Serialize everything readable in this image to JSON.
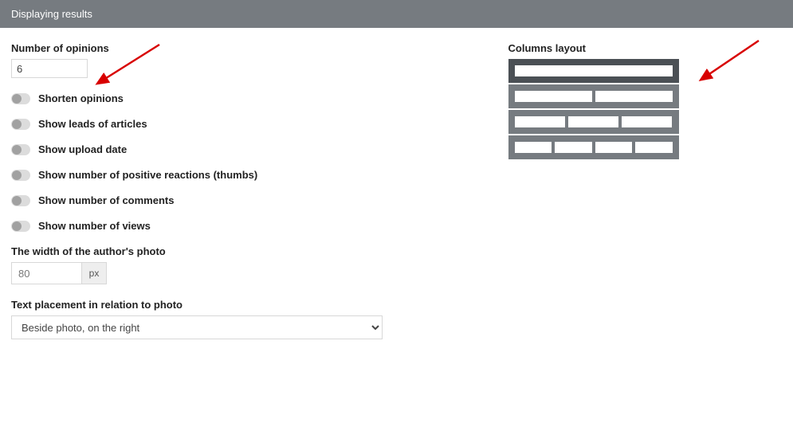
{
  "header": {
    "title": "Displaying results"
  },
  "left": {
    "number_of_opinions_label": "Number of opinions",
    "number_of_opinions_value": "6",
    "toggles": [
      {
        "label": "Shorten opinions"
      },
      {
        "label": "Show leads of articles"
      },
      {
        "label": "Show upload date"
      },
      {
        "label": "Show number of positive reactions (thumbs)"
      },
      {
        "label": "Show number of comments"
      },
      {
        "label": "Show number of views"
      }
    ],
    "author_photo_width_label": "The width of the author's photo",
    "author_photo_width_value": "80",
    "author_photo_width_unit": "px",
    "text_placement_label": "Text placement in relation to photo",
    "text_placement_value": "Beside photo, on the right"
  },
  "right": {
    "columns_layout_label": "Columns layout",
    "layouts": [
      {
        "cols": 1,
        "selected": true
      },
      {
        "cols": 2,
        "selected": false
      },
      {
        "cols": 3,
        "selected": false
      },
      {
        "cols": 4,
        "selected": false
      }
    ]
  }
}
